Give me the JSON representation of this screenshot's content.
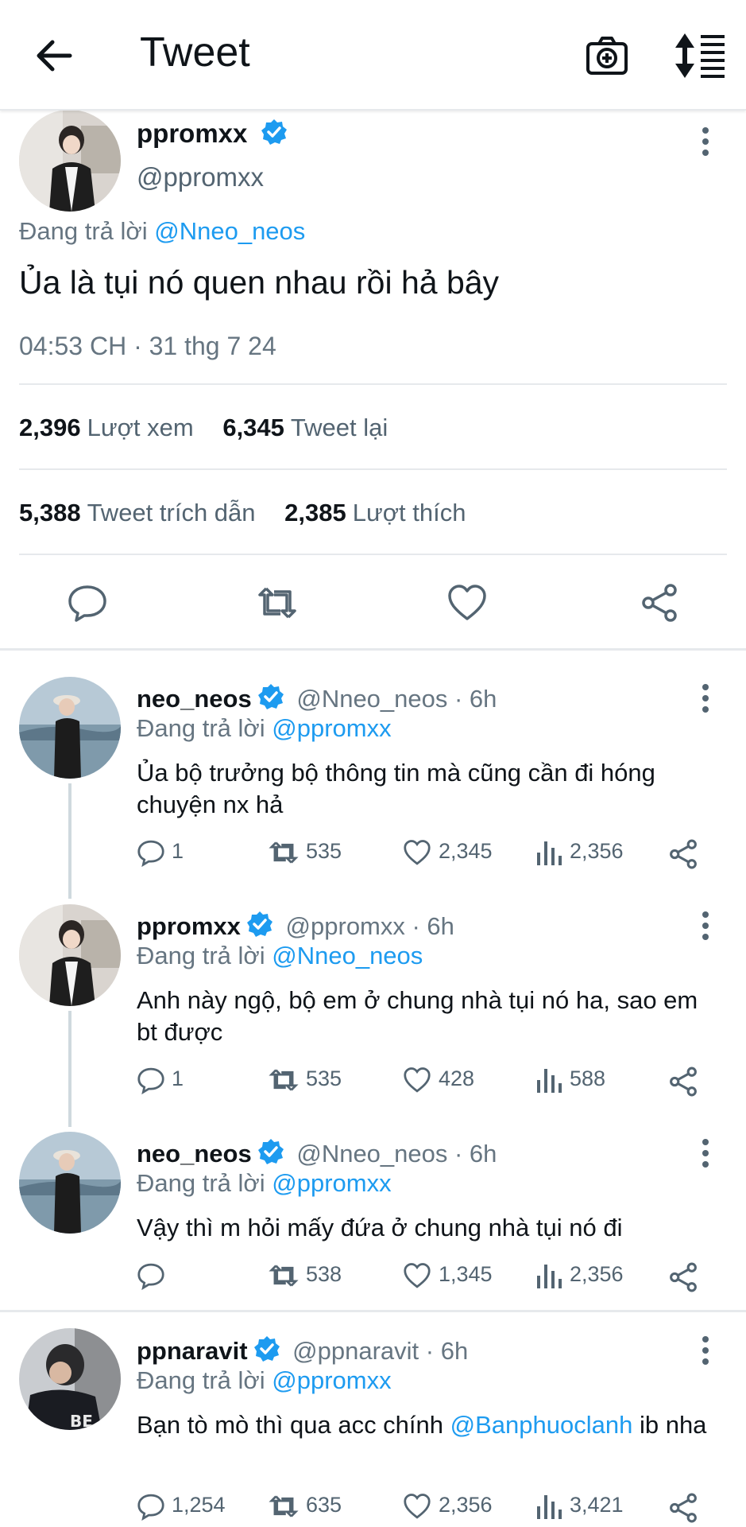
{
  "header": {
    "title": "Tweet",
    "back_icon": "arrow-left-icon",
    "camera_icon": "camera-plus-icon",
    "sort_icon": "sort-icon"
  },
  "main_tweet": {
    "name": "ppromxx",
    "handle": "@ppromxx",
    "replying_prefix": "Đang trả lời",
    "replying_to": "@Nneo_neos",
    "text": "Ủa là tụi nó quen nhau rồi hả bây",
    "timestamp": "04:53 CH · 31 thg 7 24",
    "stats": {
      "views": "2,396",
      "views_label": "Lượt xem",
      "retweets": "6,345",
      "retweets_label": "Tweet lại",
      "quotes": "5,388",
      "quotes_label": "Tweet trích dẫn",
      "likes": "2,385",
      "likes_label": "Lượt thích"
    }
  },
  "replies": [
    {
      "name": "neo_neos",
      "handle": "@Nneo_neos · 6h",
      "replying_prefix": "Đang trả lời",
      "replying_to": "@ppromxx",
      "text": "Ủa bộ trưởng bộ thông tin mà cũng cần đi hóng chuyện nx hả",
      "replies": "1",
      "retweets": "535",
      "likes": "2,345",
      "views": "2,356"
    },
    {
      "name": "ppromxx",
      "handle": "@ppromxx · 6h",
      "replying_prefix": "Đang trả lời",
      "replying_to": "@Nneo_neos",
      "text": "Anh này ngộ, bộ em ở chung nhà tụi nó ha, sao em bt được",
      "replies": "1",
      "retweets": "535",
      "likes": "428",
      "views": "588"
    },
    {
      "name": "neo_neos",
      "handle": "@Nneo_neos · 6h",
      "replying_prefix": "Đang trả lời",
      "replying_to": "@ppromxx",
      "text": "Vậy thì m hỏi mấy đứa ở chung nhà tụi nó đi",
      "replies": "",
      "retweets": "538",
      "likes": "1,345",
      "views": "2,356"
    },
    {
      "name": "ppnaravit",
      "handle": "@ppnaravit · 6h",
      "replying_prefix": "Đang trả lời",
      "replying_to": "@ppromxx",
      "text_before": "Bạn tò mò thì qua acc chính ",
      "text_mention": "@Banphuoclanh",
      "text_after": " ib nha",
      "replies": "1,254",
      "retweets": "635",
      "likes": "2,356",
      "views": "3,421"
    }
  ],
  "colors": {
    "accent": "#1d9bf0",
    "text": "#0f1419",
    "muted": "#667581",
    "divider": "#e6e9ec"
  }
}
